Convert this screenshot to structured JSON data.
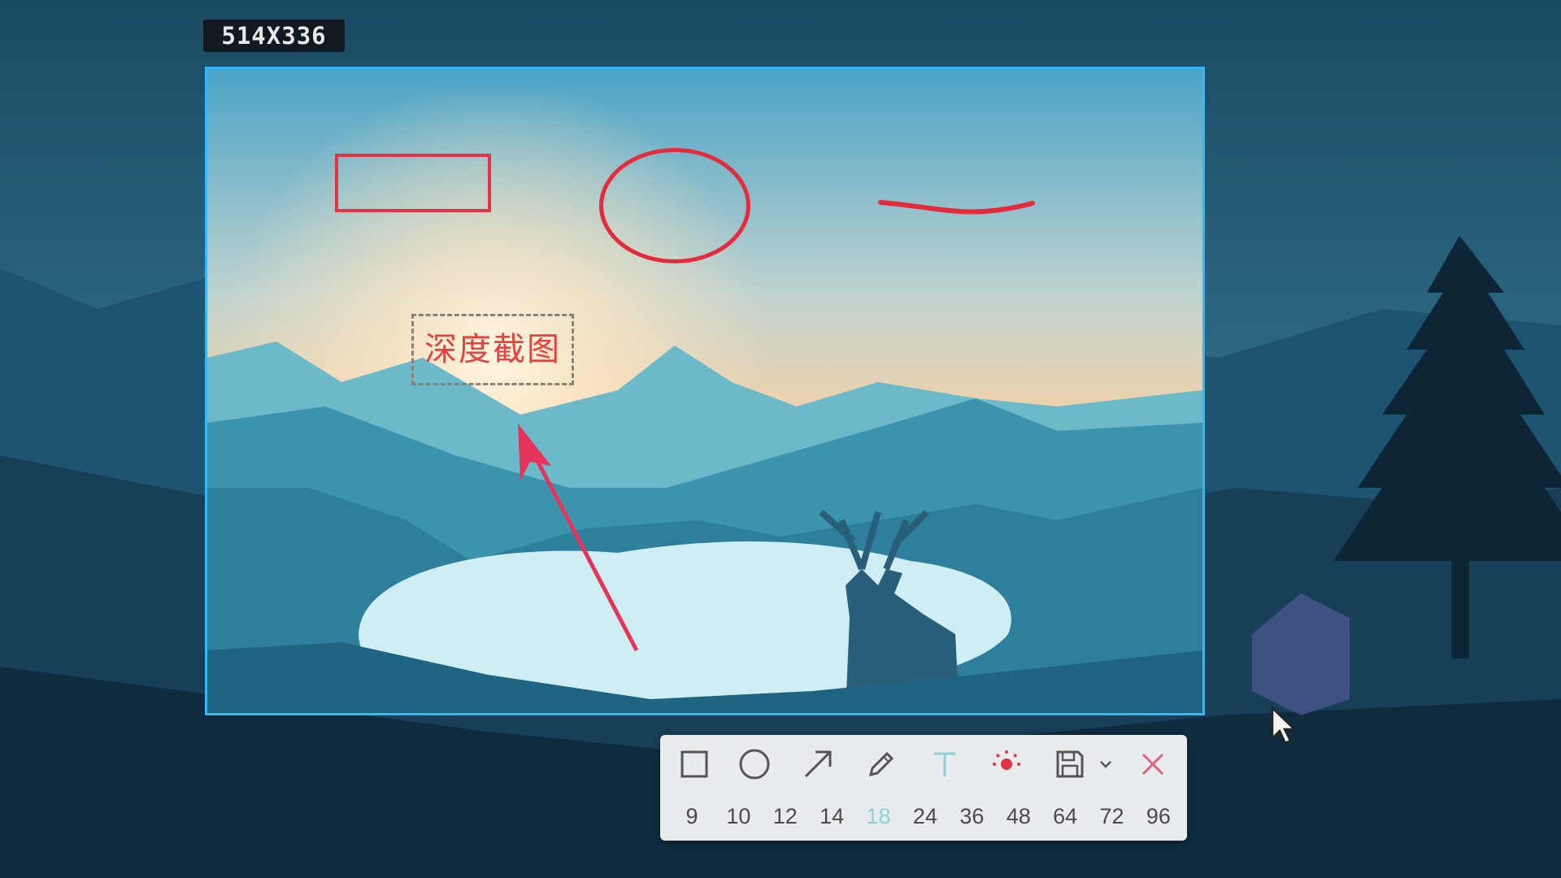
{
  "selection": {
    "size_label": "514X336"
  },
  "annotations": {
    "text_label": "深度截图",
    "color": "#e23244"
  },
  "toolbar": {
    "tools": [
      {
        "name": "rectangle-icon"
      },
      {
        "name": "ellipse-icon"
      },
      {
        "name": "arrow-icon"
      },
      {
        "name": "pencil-icon"
      },
      {
        "name": "text-icon"
      },
      {
        "name": "color-picker-icon"
      },
      {
        "name": "save-icon"
      },
      {
        "name": "chevron-down-icon"
      },
      {
        "name": "close-icon"
      }
    ],
    "font_sizes": [
      "9",
      "10",
      "12",
      "14",
      "18",
      "24",
      "36",
      "48",
      "64",
      "72",
      "96"
    ],
    "selected_font_size": "18",
    "active_color": "#e23244"
  },
  "colors": {
    "selection_border": "#35b8f5",
    "sky_top": "#4aa3c6",
    "sky_bottom": "#f3d2a8",
    "lake": "#cfeef4"
  }
}
